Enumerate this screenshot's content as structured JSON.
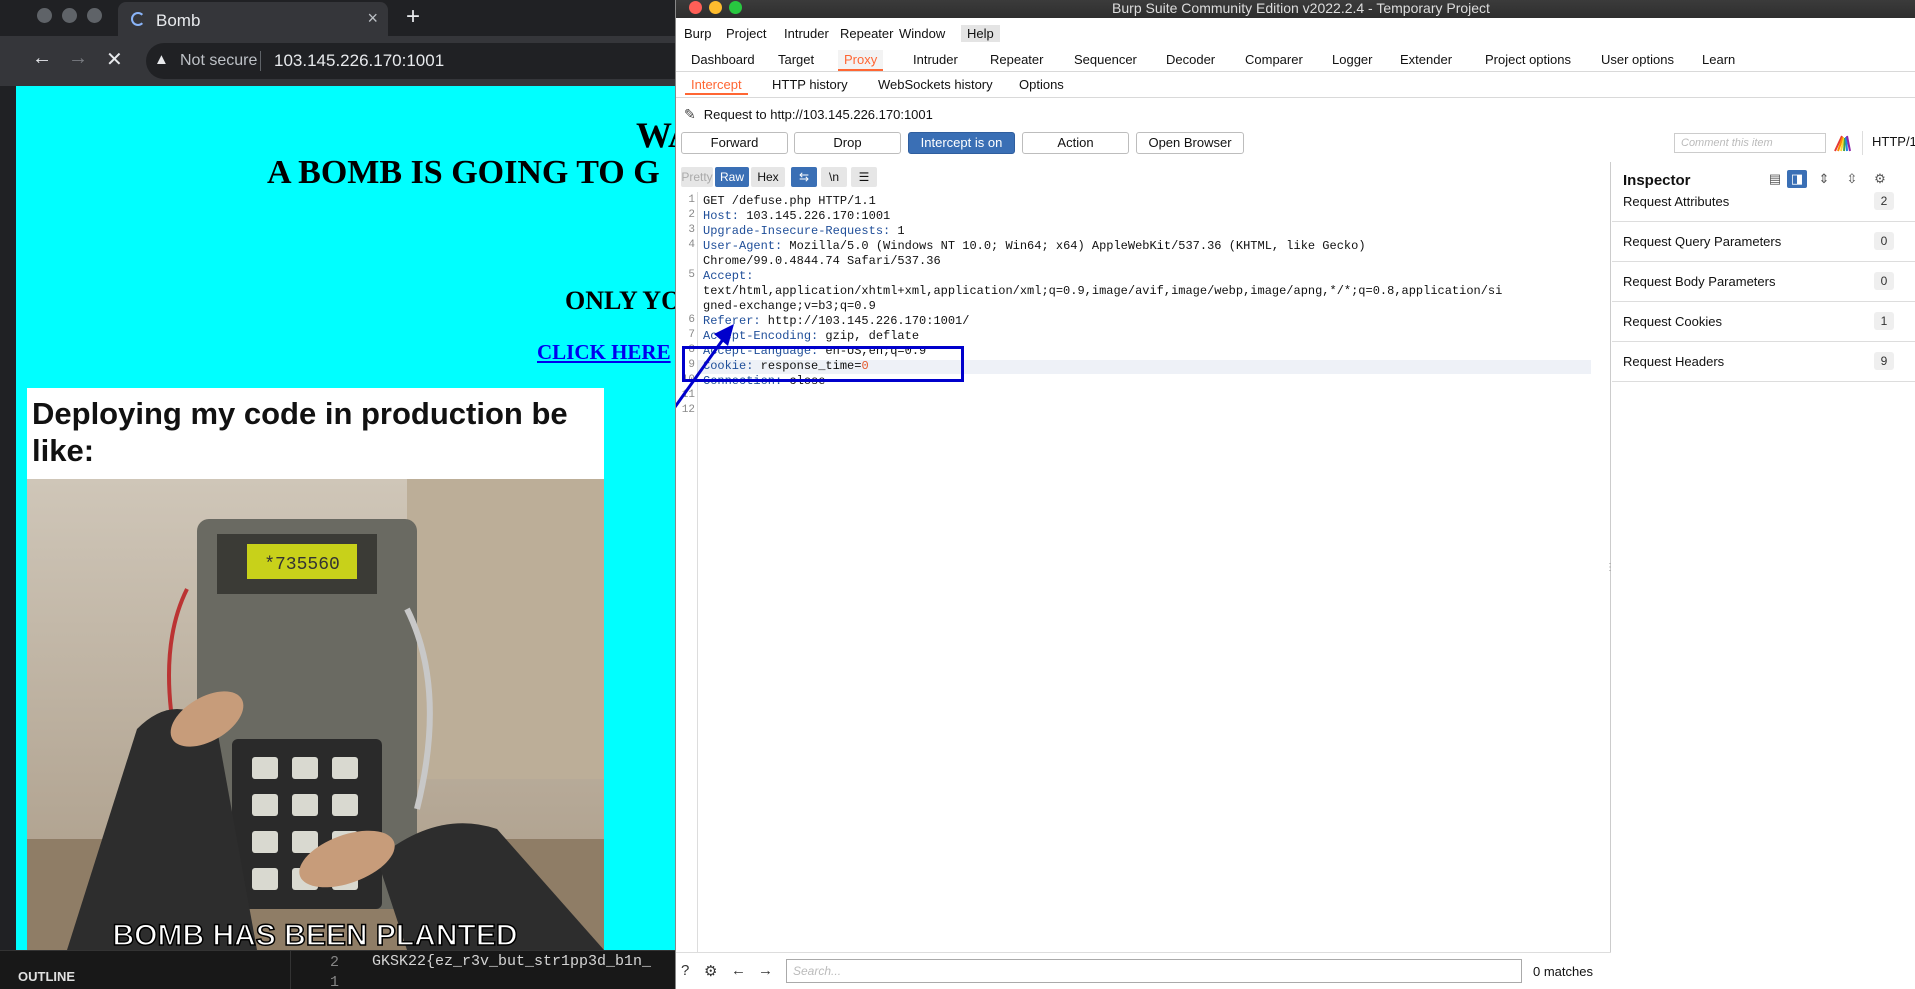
{
  "browser": {
    "tab_title": "Bomb",
    "tab_close": "×",
    "new_tab": "+",
    "security_label": "Not secure",
    "url": "103.145.226.170:1001",
    "page": {
      "heading1": "WA",
      "heading2": "A BOMB IS GOING TO G",
      "heading3": "ONLY YO",
      "link": "CLICK HERE",
      "meme_caption": "Deploying my code in production be like:",
      "meme_bottom_text": "BOMB HAS BEEN PLANTED",
      "display_text": "*735560"
    },
    "bottom_panel": {
      "outline_label": "OUTLINE",
      "line_numbers": [
        "2",
        "1"
      ],
      "code": "GKSK22{ez_r3v_but_str1pp3d_b1n_"
    }
  },
  "burp": {
    "window_title": "Burp Suite Community Edition v2022.2.4 - Temporary Project",
    "menu": [
      "Burp",
      "Project",
      "Intruder",
      "Repeater",
      "Window",
      "Help"
    ],
    "tabs": [
      "Dashboard",
      "Target",
      "Proxy",
      "Intruder",
      "Repeater",
      "Sequencer",
      "Decoder",
      "Comparer",
      "Logger",
      "Extender",
      "Project options",
      "User options",
      "Learn"
    ],
    "active_tab": "Proxy",
    "subtabs": [
      "Intercept",
      "HTTP history",
      "WebSockets history",
      "Options"
    ],
    "active_subtab": "Intercept",
    "request_label": "Request to http://103.145.226.170:1001",
    "buttons": {
      "forward": "Forward",
      "drop": "Drop",
      "intercept": "Intercept is on",
      "action": "Action",
      "open_browser": "Open Browser"
    },
    "comment_placeholder": "Comment this item",
    "http_version": "HTTP/1",
    "editor_tabs": {
      "pretty": "Pretty",
      "raw": "Raw",
      "hex": "Hex",
      "newline": "\\n"
    },
    "request_lines": [
      {
        "n": "1",
        "key": "",
        "val": "GET /defuse.php HTTP/1.1"
      },
      {
        "n": "2",
        "key": "Host:",
        "val": " 103.145.226.170:1001"
      },
      {
        "n": "3",
        "key": "Upgrade-Insecure-Requests:",
        "val": " 1"
      },
      {
        "n": "4",
        "key": "User-Agent:",
        "val": " Mozilla/5.0 (Windows NT 10.0; Win64; x64) AppleWebKit/537.36 (KHTML, like Gecko)"
      },
      {
        "n": "",
        "key": "",
        "val": "Chrome/99.0.4844.74 Safari/537.36"
      },
      {
        "n": "5",
        "key": "Accept:",
        "val": ""
      },
      {
        "n": "",
        "key": "",
        "val": "text/html,application/xhtml+xml,application/xml;q=0.9,image/avif,image/webp,image/apng,*/*;q=0.8,application/si"
      },
      {
        "n": "",
        "key": "",
        "val": "gned-exchange;v=b3;q=0.9"
      },
      {
        "n": "6",
        "key": "Referer:",
        "val": " http://103.145.226.170:1001/"
      },
      {
        "n": "7",
        "key": "Accept-Encoding:",
        "val": " gzip, deflate"
      },
      {
        "n": "8",
        "key": "Accept-Language:",
        "val": " en-US,en;q=0.9"
      },
      {
        "n": "9",
        "key": "Cookie:",
        "val": " response_time=",
        "extra": "0"
      },
      {
        "n": "10",
        "key": "Connection:",
        "val": " close"
      },
      {
        "n": "11",
        "key": "",
        "val": ""
      },
      {
        "n": "12",
        "key": "",
        "val": ""
      }
    ],
    "search_placeholder": "Search...",
    "matches": "0 matches",
    "inspector": {
      "title": "Inspector",
      "rows": [
        {
          "label": "Request Attributes",
          "count": "2"
        },
        {
          "label": "Request Query Parameters",
          "count": "0"
        },
        {
          "label": "Request Body Parameters",
          "count": "0"
        },
        {
          "label": "Request Cookies",
          "count": "1"
        },
        {
          "label": "Request Headers",
          "count": "9"
        }
      ]
    }
  }
}
